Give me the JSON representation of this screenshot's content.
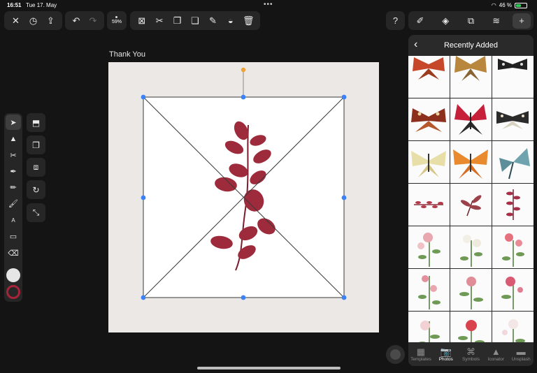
{
  "status_bar": {
    "time": "16:51",
    "date": "Tue 17. May",
    "battery": "46 %",
    "battery_level": 0.46
  },
  "toolbar": {
    "close": "✕",
    "history": "◷",
    "share": "⇪",
    "undo": "↶",
    "redo": "↷",
    "zoom": "59%",
    "transform": "⊠",
    "cut": "✂",
    "copy": "❐",
    "paste": "❏",
    "style_picker": "✎",
    "fill": "◒",
    "delete": "🗑",
    "help": "?",
    "brush_settings": "✐",
    "nodes": "◈",
    "arrange": "⧉",
    "layers": "≋",
    "add": "+"
  },
  "canvas": {
    "document_title": "Thank You",
    "accent_selection": "#3b82f6",
    "rotate_handle_color": "#f59e0b"
  },
  "tools": {
    "select": "➤",
    "direct_select": "▲",
    "scissors": "✂",
    "pen": "✒",
    "pencil": "✏",
    "brush": "🖌",
    "text": "A",
    "rectangle": "▭",
    "eraser": "⌫",
    "fill_color": "#e6e6e6",
    "stroke_color": "#a5243a"
  },
  "context_tools": {
    "clip": "⬒",
    "duplicate": "❐",
    "mask": "⧈",
    "repeat": "↻",
    "resize": "⤡"
  },
  "panel": {
    "title": "Recently Added",
    "back": "‹",
    "tabs": [
      {
        "label": "Templates",
        "icon": "▦"
      },
      {
        "label": "Photos",
        "icon": "📷"
      },
      {
        "label": "Symbols",
        "icon": "⌘"
      },
      {
        "label": "Iconator",
        "icon": "▲"
      },
      {
        "label": "Unsplash",
        "icon": "▬"
      }
    ],
    "active_tab": "Photos"
  }
}
